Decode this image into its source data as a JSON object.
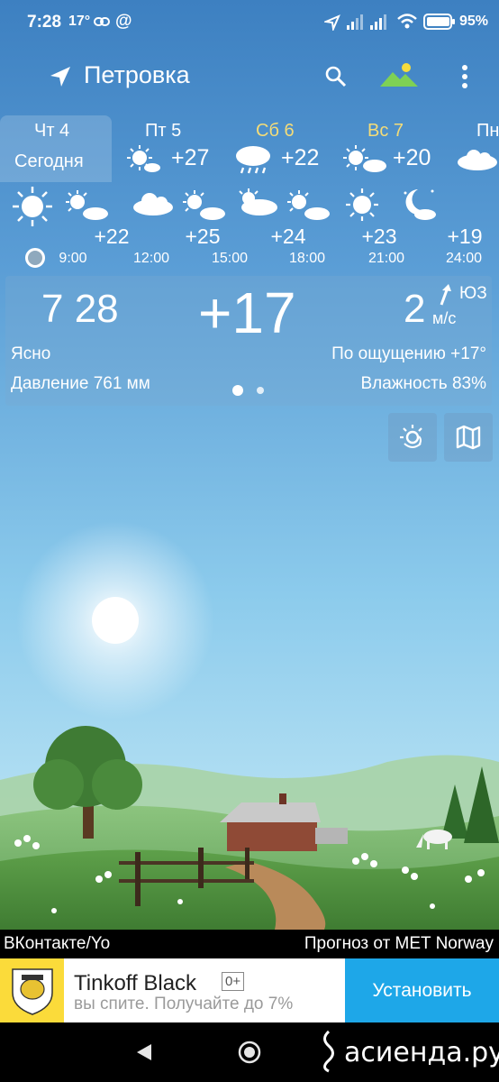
{
  "status_bar": {
    "time": "7:28",
    "small_temp": "17°",
    "battery": "95%"
  },
  "app_bar": {
    "location": "Петровка",
    "icons": [
      "location-arrow-icon",
      "search-icon",
      "landscape-theme-icon",
      "more-vert-icon"
    ]
  },
  "days": [
    {
      "name": "Чт 4",
      "sub": "Сегодня",
      "temp": "",
      "icon": "",
      "weekend": false
    },
    {
      "name": "Пт 5",
      "sub": "",
      "temp": "+27",
      "icon": "sun-cloud-icon",
      "weekend": false
    },
    {
      "name": "Сб 6",
      "sub": "",
      "temp": "+22",
      "icon": "rain-cloud-icon",
      "weekend": true
    },
    {
      "name": "Вс 7",
      "sub": "",
      "temp": "+20",
      "icon": "sun-cloud-icon",
      "weekend": true
    },
    {
      "name": "Пн",
      "sub": "",
      "temp": "",
      "icon": "cloud-icon",
      "weekend": false
    }
  ],
  "hourly": [
    {
      "time": "9:00",
      "temp": "+22"
    },
    {
      "time": "12:00",
      "temp": "+25"
    },
    {
      "time": "15:00",
      "temp": "+24"
    },
    {
      "time": "18:00",
      "temp": "+23"
    },
    {
      "time": "21:00",
      "temp": "+19"
    },
    {
      "time": "24:00",
      "temp": ""
    }
  ],
  "current": {
    "time": "7 28",
    "temp": "+17",
    "wind_speed": "2",
    "wind_unit": "м/с",
    "wind_dir": "ЮЗ",
    "condition": "Ясно",
    "feels_like": "По ощущению +17°",
    "pressure": "Давление 761 мм",
    "humidity": "Влажность 83%"
  },
  "footer": {
    "left": "ВКонтакте/Yo",
    "right": "Прогноз от MET Norway"
  },
  "ad": {
    "title": "Tinkoff Black",
    "age": "0+",
    "subtitle": "вы спите. Получайте до 7%",
    "install": "Установить"
  },
  "watermark": "асиенда.ру",
  "colors": {
    "sky_top": "#3c7fc0",
    "sky_bottom": "#a8dcf2",
    "weekend": "#f4dc78",
    "install_button": "#1ea7e8",
    "ad_logo": "#fbdb3a"
  }
}
